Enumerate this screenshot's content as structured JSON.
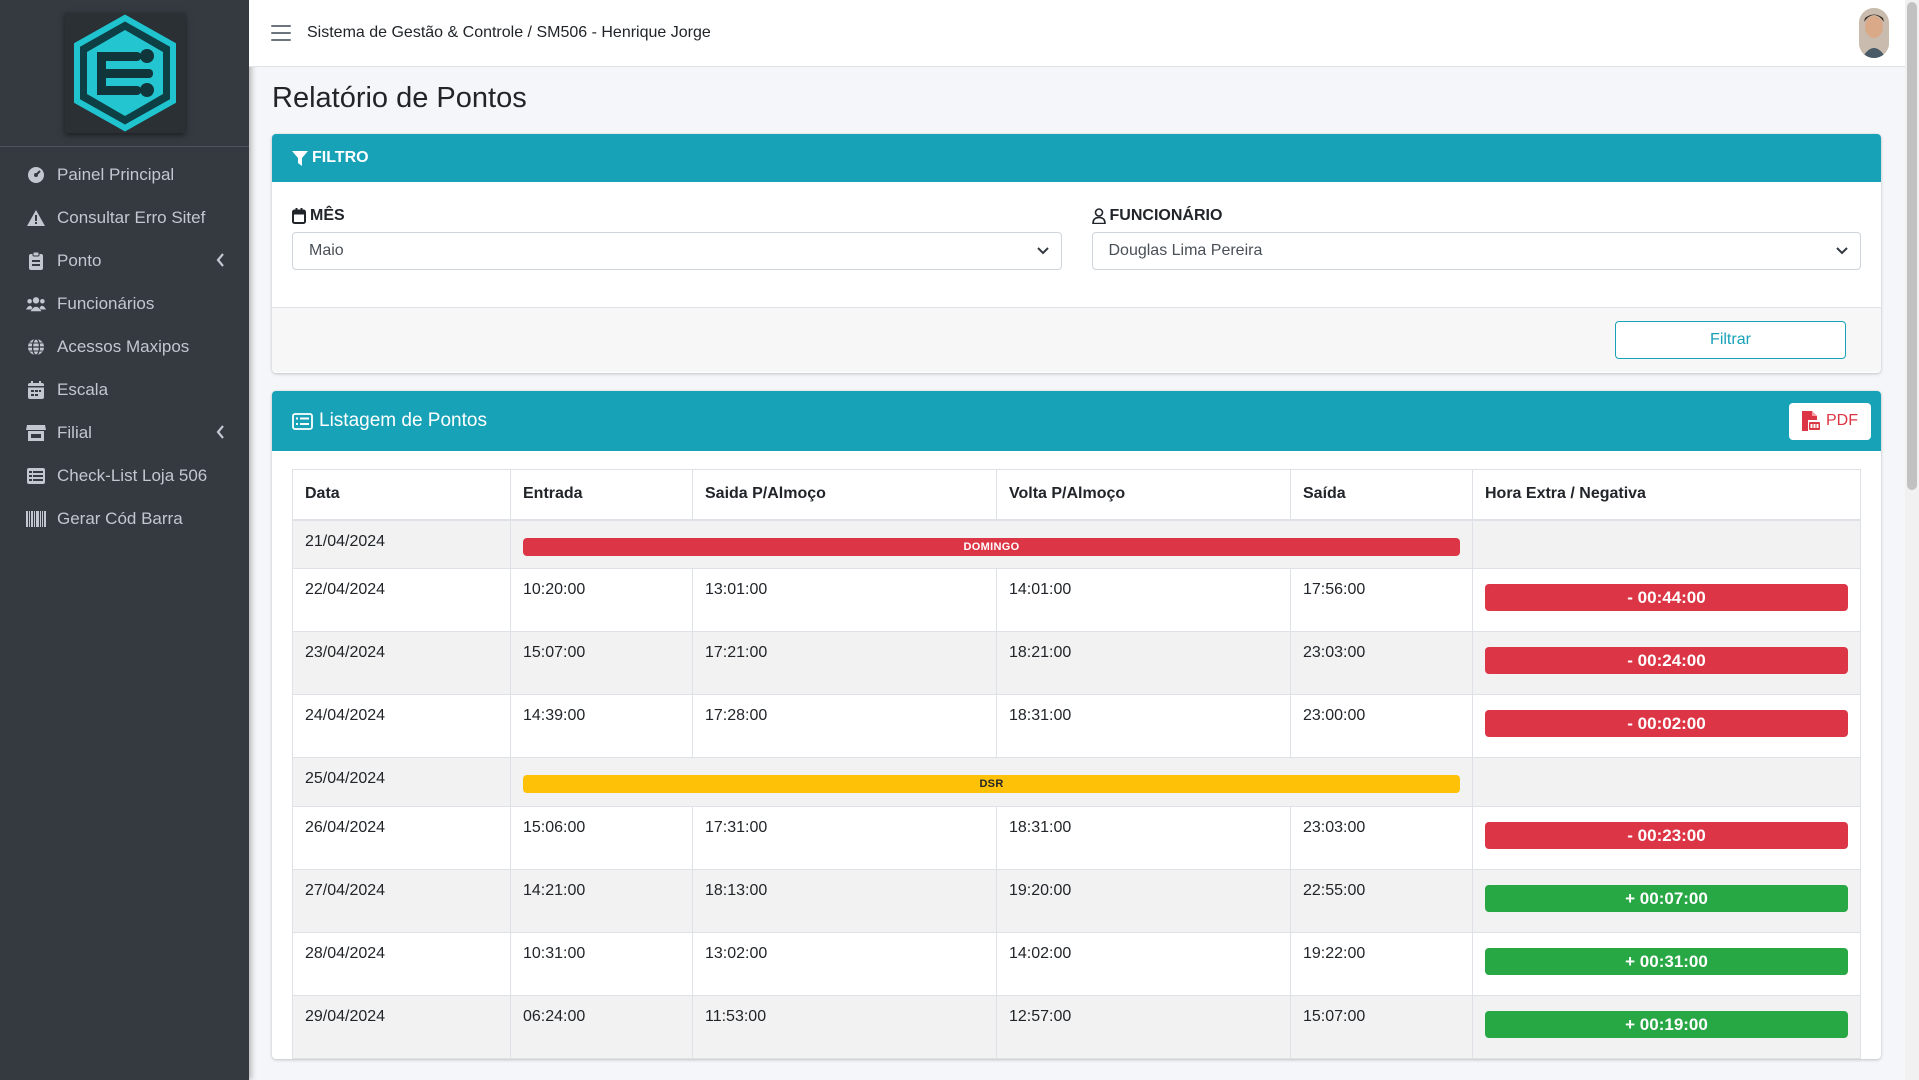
{
  "topbar": {
    "breadcrumb": "Sistema de Gestão & Controle / SM506 - Henrique Jorge"
  },
  "sidebar": {
    "items": [
      {
        "label": "Painel Principal",
        "icon": "dashboard-icon"
      },
      {
        "label": "Consultar Erro Sitef",
        "icon": "warning-icon"
      },
      {
        "label": "Ponto",
        "icon": "clipboard-icon",
        "has_submenu": true
      },
      {
        "label": "Funcionários",
        "icon": "users-icon"
      },
      {
        "label": "Acessos Maxipos",
        "icon": "globe-icon"
      },
      {
        "label": "Escala",
        "icon": "calendar-icon"
      },
      {
        "label": "Filial",
        "icon": "store-icon",
        "has_submenu": true
      },
      {
        "label": "Check-List Loja 506",
        "icon": "table-list-icon"
      },
      {
        "label": "Gerar Cód Barra",
        "icon": "barcode-icon"
      }
    ]
  },
  "page": {
    "title": "Relatório de Pontos"
  },
  "filter": {
    "header": "FILTRO",
    "month_label": "MÊS",
    "month_value": "Maio",
    "employee_label": "FUNCIONÁRIO",
    "employee_value": "Douglas Lima Pereira",
    "button": "Filtrar"
  },
  "list": {
    "header": "Listagem de Pontos",
    "pdf_label": "PDF",
    "columns": [
      "Data",
      "Entrada",
      "Saida P/Almoço",
      "Volta P/Almoço",
      "Saída",
      "Hora Extra / Negativa"
    ],
    "rows": [
      {
        "date": "21/04/2024",
        "special": "DOMINGO",
        "special_type": "danger"
      },
      {
        "date": "22/04/2024",
        "in": "10:20:00",
        "lunch_out": "13:01:00",
        "lunch_in": "14:01:00",
        "out": "17:56:00",
        "balance": "- 00:44:00",
        "balance_type": "neg"
      },
      {
        "date": "23/04/2024",
        "in": "15:07:00",
        "lunch_out": "17:21:00",
        "lunch_in": "18:21:00",
        "out": "23:03:00",
        "balance": "- 00:24:00",
        "balance_type": "neg"
      },
      {
        "date": "24/04/2024",
        "in": "14:39:00",
        "lunch_out": "17:28:00",
        "lunch_in": "18:31:00",
        "out": "23:00:00",
        "balance": "- 00:02:00",
        "balance_type": "neg"
      },
      {
        "date": "25/04/2024",
        "special": "DSR",
        "special_type": "warning"
      },
      {
        "date": "26/04/2024",
        "in": "15:06:00",
        "lunch_out": "17:31:00",
        "lunch_in": "18:31:00",
        "out": "23:03:00",
        "balance": "- 00:23:00",
        "balance_type": "neg"
      },
      {
        "date": "27/04/2024",
        "in": "14:21:00",
        "lunch_out": "18:13:00",
        "lunch_in": "19:20:00",
        "out": "22:55:00",
        "balance": "+ 00:07:00",
        "balance_type": "pos"
      },
      {
        "date": "28/04/2024",
        "in": "10:31:00",
        "lunch_out": "13:02:00",
        "lunch_in": "14:02:00",
        "out": "19:22:00",
        "balance": "+ 00:31:00",
        "balance_type": "pos"
      },
      {
        "date": "29/04/2024",
        "in": "06:24:00",
        "lunch_out": "11:53:00",
        "lunch_in": "12:57:00",
        "out": "15:07:00",
        "balance": "+ 00:19:00",
        "balance_type": "pos"
      }
    ]
  }
}
